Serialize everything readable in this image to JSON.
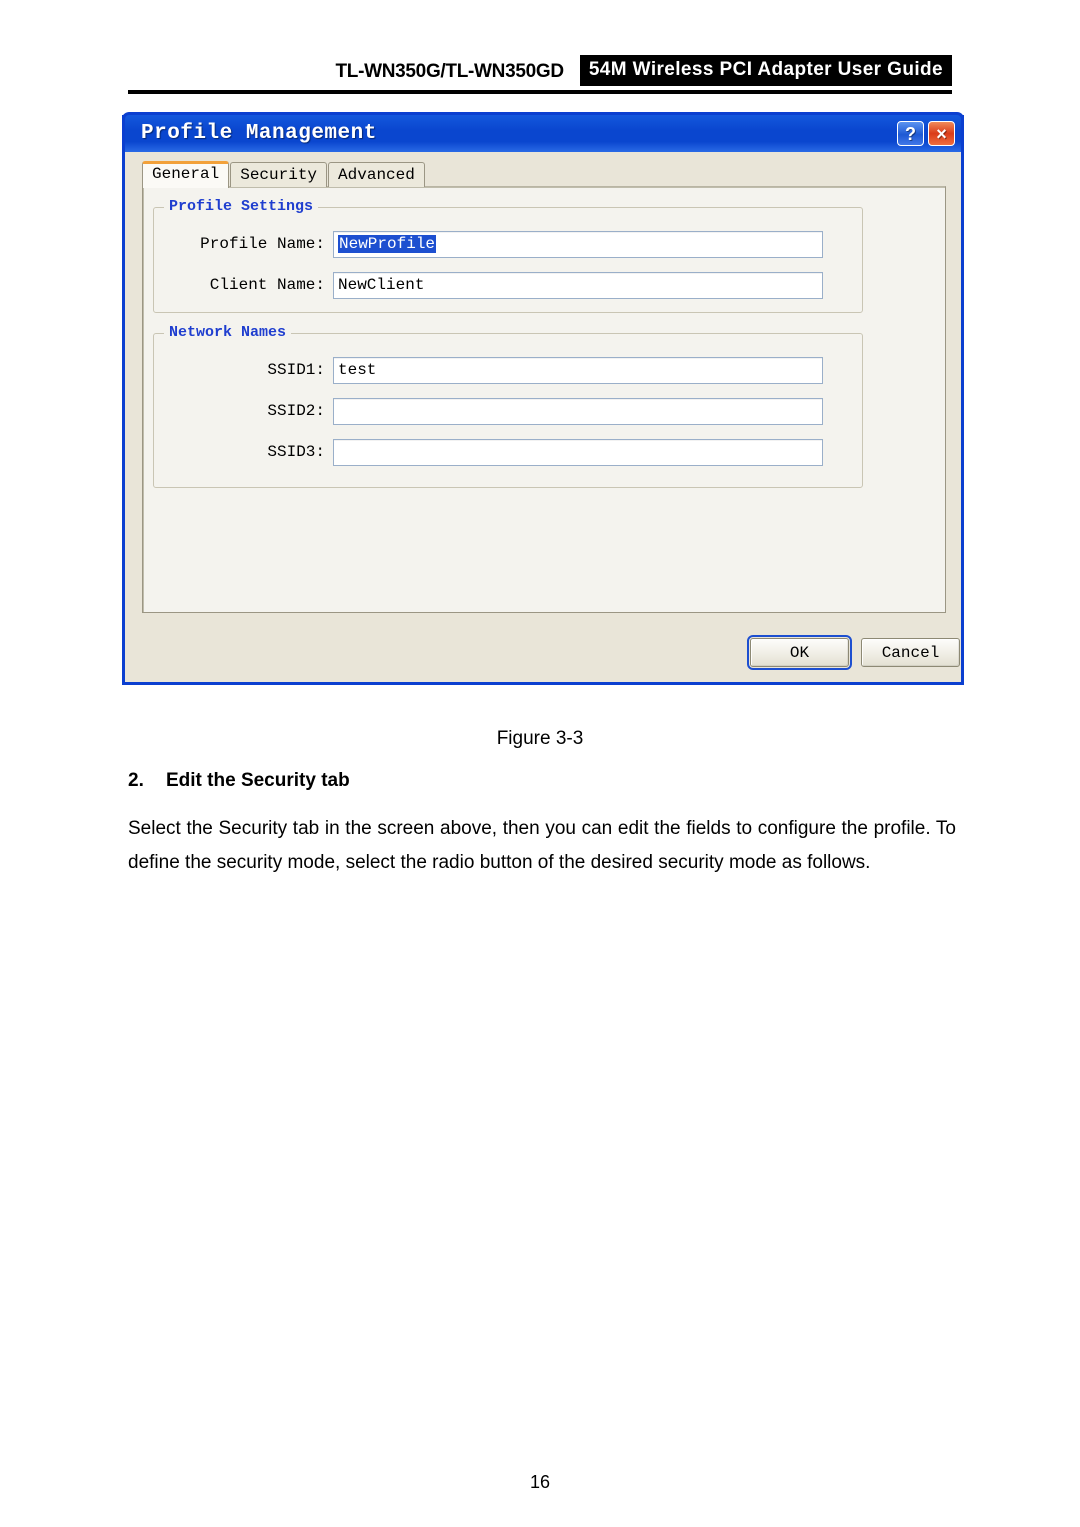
{
  "header": {
    "model": "TL-WN350G/TL-WN350GD",
    "badge": "54M Wireless PCI Adapter User Guide"
  },
  "dialog": {
    "title": "Profile Management",
    "titlebar_buttons": {
      "help": "?",
      "close": "×"
    },
    "tabs": [
      {
        "label": "General",
        "active": true
      },
      {
        "label": "Security",
        "active": false
      },
      {
        "label": "Advanced",
        "active": false
      }
    ],
    "groups": {
      "profile_settings": {
        "legend": "Profile Settings",
        "fields": [
          {
            "label": "Profile Name:",
            "value": "NewProfile",
            "selected": true
          },
          {
            "label": "Client Name:",
            "value": "NewClient",
            "selected": false
          }
        ]
      },
      "network_names": {
        "legend": "Network Names",
        "fields": [
          {
            "label": "SSID1:",
            "value": "test"
          },
          {
            "label": "SSID2:",
            "value": ""
          },
          {
            "label": "SSID3:",
            "value": ""
          }
        ]
      }
    },
    "buttons": {
      "ok": "OK",
      "cancel": "Cancel"
    }
  },
  "document": {
    "figure_caption": "Figure 3-3",
    "step_number": "2.",
    "step_title": "Edit the Security tab",
    "paragraph": "Select the Security tab in the screen above, then you can edit the fields to configure the profile. To define the security mode, select the radio button of the desired security mode as follows.",
    "page_number": "16"
  },
  "colors": {
    "titlebar_blue": "#0a46cf",
    "dialog_border": "#0b3fd0",
    "dialog_face": "#e9e5d8",
    "panel_face": "#f4f3ee",
    "legend_blue": "#1f3ecf",
    "active_tab_accent": "#f2a13a",
    "selection_blue": "#1d4fd0",
    "close_red": "#da3c19"
  }
}
